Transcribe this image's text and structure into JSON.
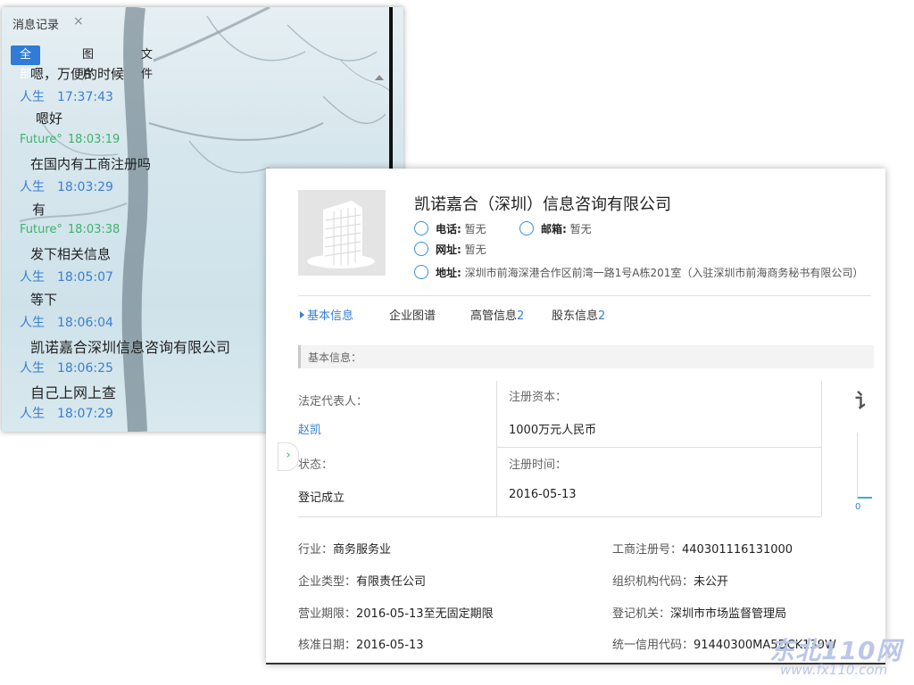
{
  "chat": {
    "title": "消息记录",
    "close": "×",
    "tabs": [
      "全部",
      "图片",
      "文件"
    ],
    "cut_text": "嗯，万便的时候",
    "messages": [
      {
        "sender": "人生",
        "time": "17:37:43",
        "kind": "human",
        "text": "嗯好"
      },
      {
        "sender": "Future°",
        "time": "18:03:19",
        "kind": "future",
        "text": "在国内有工商注册吗"
      },
      {
        "sender": "人生",
        "time": "18:03:29",
        "kind": "human",
        "text": "有"
      },
      {
        "sender": "Future°",
        "time": "18:03:38",
        "kind": "future",
        "text": "发下相关信息"
      },
      {
        "sender": "人生",
        "time": "18:05:07",
        "kind": "human",
        "text": "等下"
      },
      {
        "sender": "人生",
        "time": "18:06:04",
        "kind": "human",
        "text": "凯诺嘉合深圳信息咨询有限公司"
      },
      {
        "sender": "人生",
        "time": "18:06:25",
        "kind": "human",
        "text": "自己上网上查"
      },
      {
        "sender": "人生",
        "time": "18:07:29",
        "kind": "human",
        "text": ""
      }
    ]
  },
  "company": {
    "name": "凯诺嘉合（深圳）信息咨询有限公司",
    "phone_label": "电话:",
    "phone": "暂无",
    "email_label": "邮箱:",
    "email": "暂无",
    "website_label": "网址:",
    "website": "暂无",
    "address_label": "地址:",
    "address": "深圳市前海深港合作区前湾一路1号A栋201室（入驻深圳市前海商务秘书有限公司）",
    "tabs": [
      {
        "label": "基本信息",
        "count": ""
      },
      {
        "label": "企业图谱",
        "count": ""
      },
      {
        "label": "高管信息",
        "count": "2"
      },
      {
        "label": "股东信息",
        "count": "2"
      }
    ],
    "section_title": "基本信息：",
    "legal_rep_label": "法定代表人：",
    "legal_rep": "赵凯",
    "reg_capital_label": "注册资本：",
    "reg_capital": "1000万元人民币",
    "status_label": "状态：",
    "status": "登记成立",
    "reg_time_label": "注册时间：",
    "reg_time": "2016-05-13",
    "side_char": "讠",
    "side_zero": "0",
    "expand": "›",
    "details": [
      {
        "k": "行业：",
        "v": "商务服务业"
      },
      {
        "k": "工商注册号：",
        "v": "440301116131000"
      },
      {
        "k": "企业类型：",
        "v": "有限责任公司"
      },
      {
        "k": "组织机构代码：",
        "v": "未公开"
      },
      {
        "k": "营业期限：",
        "v": "2016-05-13至无固定期限"
      },
      {
        "k": "登记机关：",
        "v": "深圳市市场监督管理局"
      },
      {
        "k": "核准日期：",
        "v": "2016-05-13"
      },
      {
        "k": "统一信用代码：",
        "v": "91440300MA5DCK139W"
      }
    ]
  },
  "watermark": {
    "big": "东北110网",
    "small": "www.fx110.com"
  }
}
